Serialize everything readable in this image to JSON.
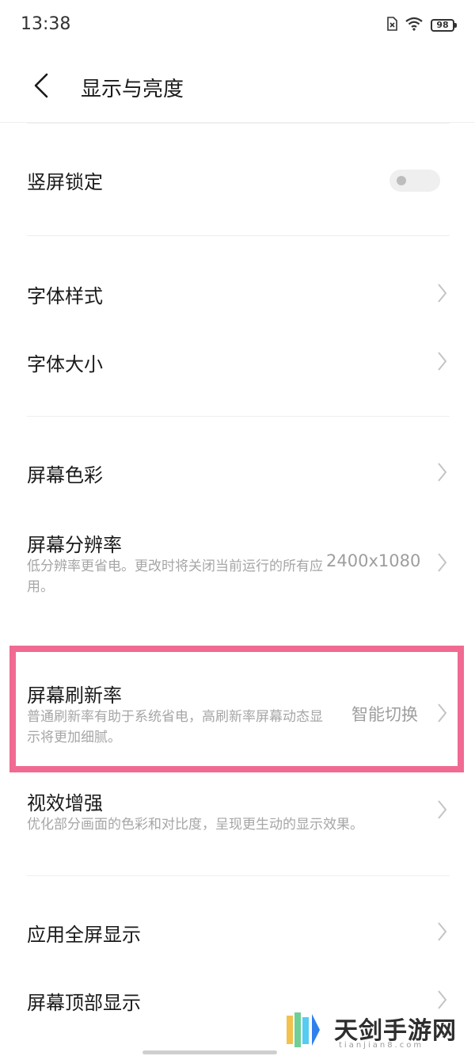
{
  "status_bar": {
    "time": "13:38",
    "battery": "98"
  },
  "header": {
    "title": "显示与亮度"
  },
  "settings": {
    "rotation_lock": {
      "title": "竖屏锁定",
      "enabled": false
    },
    "font_style": {
      "title": "字体样式"
    },
    "font_size": {
      "title": "字体大小"
    },
    "screen_color": {
      "title": "屏幕色彩"
    },
    "resolution": {
      "title": "屏幕分辨率",
      "desc": "低分辨率更省电。更改时将关闭当前运行的所有应用。",
      "value": "2400x1080"
    },
    "refresh_rate": {
      "title": "屏幕刷新率",
      "desc": "普通刷新率有助于系统省电，高刷新率屏幕动态显示将更加细腻。",
      "value": "智能切换"
    },
    "visual_enhance": {
      "title": "视效增强",
      "desc": "优化部分画面的色彩和对比度，呈现更生动的显示效果。"
    },
    "app_fullscreen": {
      "title": "应用全屏显示"
    },
    "top_display": {
      "title": "屏幕顶部显示"
    }
  },
  "watermark": {
    "text": "天剑手游网",
    "sub": "tianjian8.com"
  },
  "colors": {
    "highlight": "#f06a92",
    "secondary_text": "#a6a6a6"
  }
}
